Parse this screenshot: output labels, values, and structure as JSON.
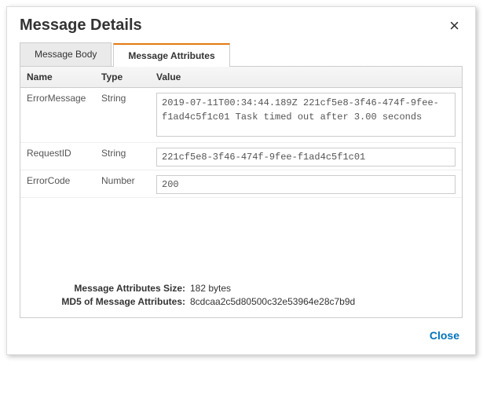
{
  "dialog": {
    "title": "Message Details",
    "close_x": "×"
  },
  "tabs": {
    "body": "Message Body",
    "attributes": "Message Attributes"
  },
  "columns": {
    "name": "Name",
    "type": "Type",
    "value": "Value"
  },
  "rows": {
    "r0": {
      "name": "ErrorMessage",
      "type": "String",
      "value": "2019-07-11T00:34:44.189Z 221cf5e8-3f46-474f-9fee-f1ad4c5f1c01 Task timed out after 3.00 seconds"
    },
    "r1": {
      "name": "RequestID",
      "type": "String",
      "value": "221cf5e8-3f46-474f-9fee-f1ad4c5f1c01"
    },
    "r2": {
      "name": "ErrorCode",
      "type": "Number",
      "value": "200"
    }
  },
  "meta": {
    "size_label": "Message Attributes Size:",
    "size_value": "182 bytes",
    "md5_label": "MD5 of Message Attributes:",
    "md5_value": "8cdcaa2c5d80500c32e53964e28c7b9d"
  },
  "footer": {
    "close": "Close"
  }
}
